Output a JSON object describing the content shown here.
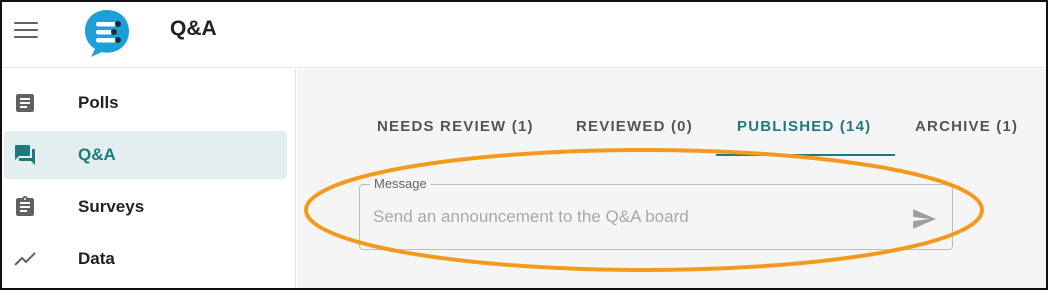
{
  "header": {
    "title": "Q&A",
    "menu_icon": "hamburger-menu-icon",
    "logo_icon": "chat-bubble-logo-icon",
    "brand_color": "#1e9fd8"
  },
  "sidebar": {
    "items": [
      {
        "label": "Polls",
        "icon": "poll-document-icon",
        "active": false
      },
      {
        "label": "Q&A",
        "icon": "forum-chat-icon",
        "active": true
      },
      {
        "label": "Surveys",
        "icon": "clipboard-icon",
        "active": false
      },
      {
        "label": "Data",
        "icon": "trending-line-icon",
        "active": false
      }
    ],
    "active_color": "#1f7a80",
    "active_bg": "#e3efef"
  },
  "main": {
    "tabs": [
      {
        "label": "NEEDS REVIEW (1)",
        "active": false
      },
      {
        "label": "REVIEWED (0)",
        "active": false
      },
      {
        "label": "PUBLISHED (14)",
        "active": true
      },
      {
        "label": "ARCHIVE (1)",
        "active": false
      }
    ],
    "message": {
      "label": "Message",
      "placeholder": "Send an announcement to the Q&A board",
      "value": "",
      "send_icon": "send-arrow-icon"
    },
    "annotation_color": "#f39a1e"
  }
}
